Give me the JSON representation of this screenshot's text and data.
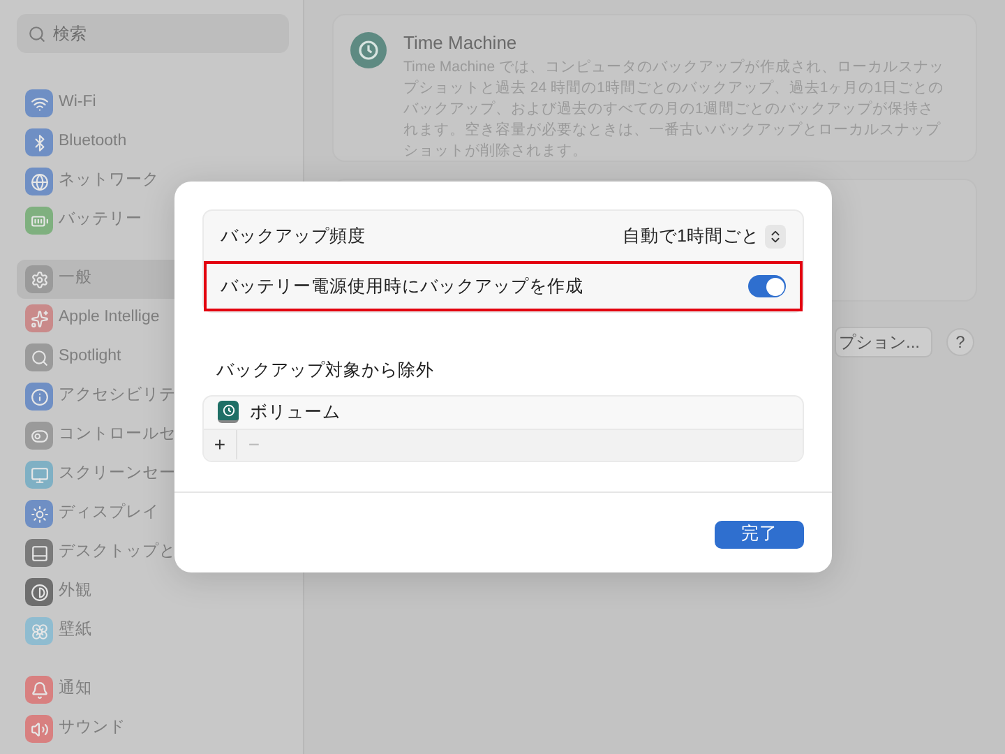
{
  "sidebar": {
    "search": {
      "placeholder": "検索"
    },
    "groups": [
      [
        {
          "label": "Wi-Fi",
          "color": "#6f8fc4"
        },
        {
          "label": "Bluetooth",
          "color": "#6f8fc4"
        },
        {
          "label": "ネットワーク",
          "color": "#6f8fc4"
        },
        {
          "label": "バッテリー",
          "color": "#7fb07f"
        }
      ],
      [
        {
          "label": "一般",
          "color": "#9a9a9a",
          "selected": true
        },
        {
          "label": "Apple Intellige",
          "color": "#c98a8a",
          "selected": false
        },
        {
          "label": "Spotlight",
          "color": "#9a9a9a",
          "selected": false
        },
        {
          "label": "アクセシビリテ",
          "color": "#6f8fc4",
          "selected": false
        },
        {
          "label": "コントロールセ",
          "color": "#9a9a9a",
          "selected": false
        },
        {
          "label": "スクリーンセー",
          "color": "#7fb0c4",
          "selected": false
        },
        {
          "label": "ディスプレイ",
          "color": "#6f8fc4",
          "selected": false
        },
        {
          "label": "デスクトップと",
          "color": "#7a7a7a",
          "selected": false
        },
        {
          "label": "外観",
          "color": "#6e6e6e",
          "selected": false
        },
        {
          "label": "壁紙",
          "color": "#8fbcd0",
          "selected": false
        }
      ],
      [
        {
          "label": "通知",
          "color": "#d88080"
        },
        {
          "label": "サウンド",
          "color": "#d88080"
        }
      ]
    ]
  },
  "content": {
    "card": {
      "title": "Time Machine",
      "description": "Time Machine では、コンピュータのバックアップが作成され、ローカルスナップショットと過去 24 時間の1時間ごとのバックアップ、過去1ヶ月の1日ごとのバックアップ、および過去のすべての月の1週間ごとのバックアップが保持されます。空き容量が必要なときは、一番古いバックアップとローカルスナップショットが削除されます。"
    },
    "options_button": "プション...",
    "help_button": "?"
  },
  "dialog": {
    "rows": [
      {
        "kind": "select",
        "label": "バックアップ頻度",
        "value": "自動で1時間ごと",
        "highlighted": false
      },
      {
        "kind": "toggle",
        "label": "バッテリー電源使用時にバックアップを作成",
        "on": true,
        "highlighted": true
      }
    ],
    "exclusions": {
      "title": "バックアップ対象から除外",
      "items": [
        "ボリューム"
      ],
      "add": {
        "label": "+",
        "disabled": false
      },
      "remove": {
        "label": "−",
        "disabled": true
      }
    },
    "done_button": "完了"
  }
}
